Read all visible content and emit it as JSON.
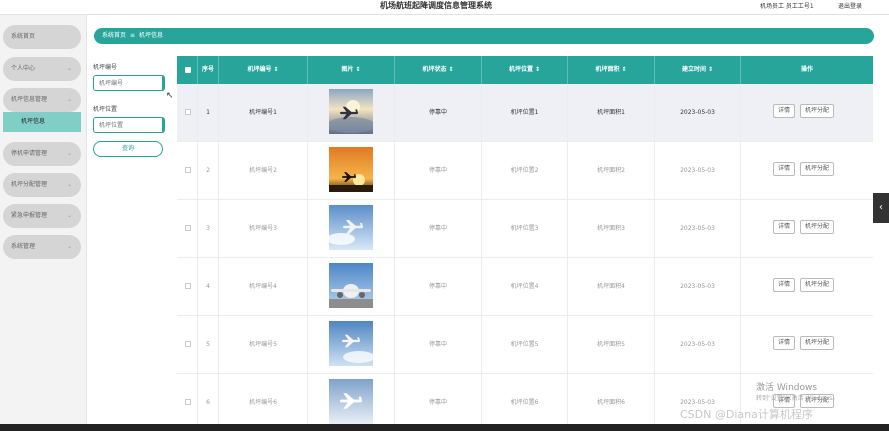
{
  "header": {
    "title": "机场航班起降调度信息管理系统",
    "user_text": "机场员工 员工工号1",
    "logout": "退出登录"
  },
  "sidebar": {
    "items": [
      {
        "label": "系统首页",
        "chevron": ""
      },
      {
        "label": "个人中心",
        "chevron": "⌄"
      },
      {
        "label": "机坪信息管理",
        "chevron": "⌄"
      },
      {
        "label": "机坪信息",
        "chevron": ""
      },
      {
        "label": "停机申请管理",
        "chevron": "⌄"
      },
      {
        "label": "机坪分配管理",
        "chevron": "⌄"
      },
      {
        "label": "紧急申报管理",
        "chevron": "⌄"
      },
      {
        "label": "系统管理",
        "chevron": "⌄"
      }
    ]
  },
  "breadcrumb": {
    "home": "系统首页",
    "sep": "≡",
    "current": "机坪信息"
  },
  "filters": {
    "field1_label": "机坪编号",
    "field1_placeholder": "机坪编号",
    "field2_label": "机坪位置",
    "field2_placeholder": "机坪位置",
    "query_button": "查询"
  },
  "table": {
    "columns": [
      "序号",
      "机坪编号 ⇕",
      "图片 ⇕",
      "机坪状态 ⇕",
      "机坪位置 ⇕",
      "机坪面积 ⇕",
      "建立时间 ⇕",
      "操作"
    ],
    "rows": [
      {
        "index": "1",
        "code": "机坪编号1",
        "status": "停靠中",
        "location": "机坪位置1",
        "area": "机坪面积1",
        "created": "2023-05-03",
        "image": "plane-in-clouds-sunlit"
      },
      {
        "index": "2",
        "code": "机坪编号2",
        "status": "停靠中",
        "location": "机坪位置2",
        "area": "机坪面积2",
        "created": "2023-05-03",
        "image": "plane-sunset"
      },
      {
        "index": "3",
        "code": "机坪编号3",
        "status": "停靠中",
        "location": "机坪位置3",
        "area": "机坪面积3",
        "created": "2023-05-03",
        "image": "plane-blue-sky"
      },
      {
        "index": "4",
        "code": "机坪编号4",
        "status": "停靠中",
        "location": "机坪位置4",
        "area": "机坪面积4",
        "created": "2023-05-03",
        "image": "plane-front-view"
      },
      {
        "index": "5",
        "code": "机坪编号5",
        "status": "停靠中",
        "location": "机坪位置5",
        "area": "机坪面积5",
        "created": "2023-05-03",
        "image": "plane-blue-sky-2"
      },
      {
        "index": "6",
        "code": "机坪编号6",
        "status": "停靠中",
        "location": "机坪位置6",
        "area": "机坪面积6",
        "created": "2023-05-03",
        "image": "plane-white-sky"
      }
    ],
    "action_detail": "详情",
    "action_assign": "机坪分配"
  },
  "overlay": {
    "watermark_line1": "激活 Windows",
    "watermark_line2": "转到\"设置\"以激活 Windows。",
    "csdn": "CSDN @Diana计算机程序"
  },
  "colors": {
    "accent": "#27a59b",
    "active_nav": "#7fcfc6",
    "nav_pill": "#d5d5d5"
  }
}
